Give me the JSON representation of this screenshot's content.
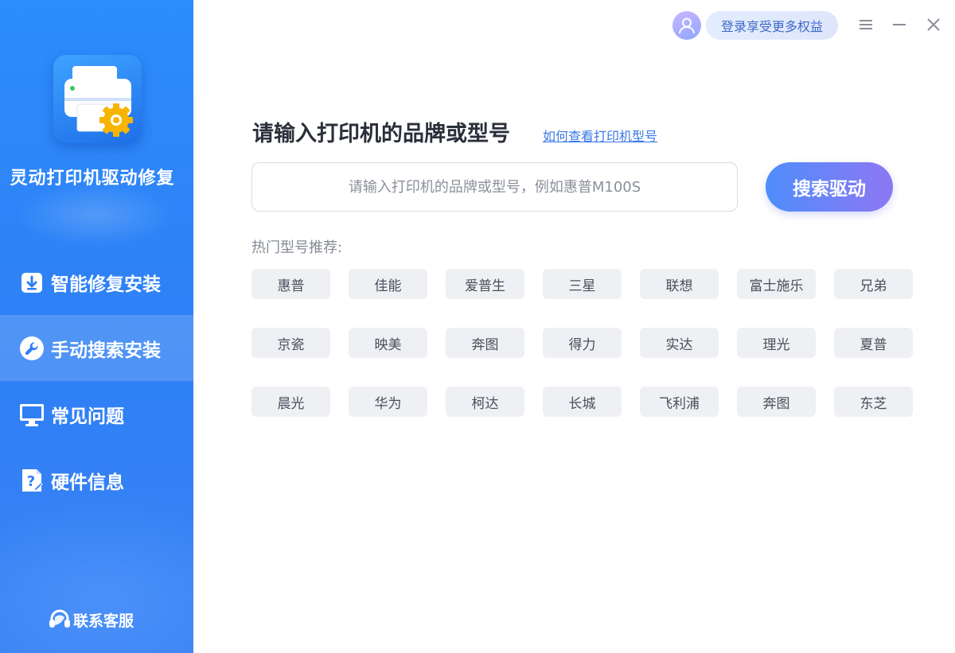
{
  "app": {
    "name": "灵动打印机驱动修复",
    "logo_icon": "printer-gear-icon"
  },
  "sidebar": {
    "items": [
      {
        "label": "智能修复安装",
        "icon": "download-box-icon",
        "active": false
      },
      {
        "label": "手动搜索安装",
        "icon": "wrench-icon",
        "active": true
      },
      {
        "label": "常见问题",
        "icon": "monitor-icon",
        "active": false
      },
      {
        "label": "硬件信息",
        "icon": "question-doc-icon",
        "active": false
      }
    ],
    "support_label": "联系客服",
    "support_icon": "headset-icon"
  },
  "topbar": {
    "avatar_icon": "user-avatar-icon",
    "login_label": "登录享受更多权益",
    "menu_icon": "menu-icon",
    "minimize_icon": "minimize-icon",
    "close_icon": "close-icon"
  },
  "main": {
    "title": "请输入打印机的品牌或型号",
    "help_link": "如何查看打印机型号",
    "search_placeholder": "请输入打印机的品牌或型号，例如惠普M100S",
    "search_value": "",
    "search_button": "搜索驱动",
    "hot_label": "热门型号推荐:",
    "hot_tags": [
      "惠普",
      "佳能",
      "爱普生",
      "三星",
      "联想",
      "富士施乐",
      "兄弟",
      "京瓷",
      "映美",
      "奔图",
      "得力",
      "实达",
      "理光",
      "夏普",
      "晨光",
      "华为",
      "柯达",
      "长城",
      "飞利浦",
      "奔图",
      "东芝"
    ]
  },
  "colors": {
    "sidebar_bg": "#2f7ff5",
    "accent_start": "#4f8dfb",
    "accent_end": "#8d78f3",
    "link": "#3a78e6",
    "tag_bg": "#eef0f4"
  }
}
